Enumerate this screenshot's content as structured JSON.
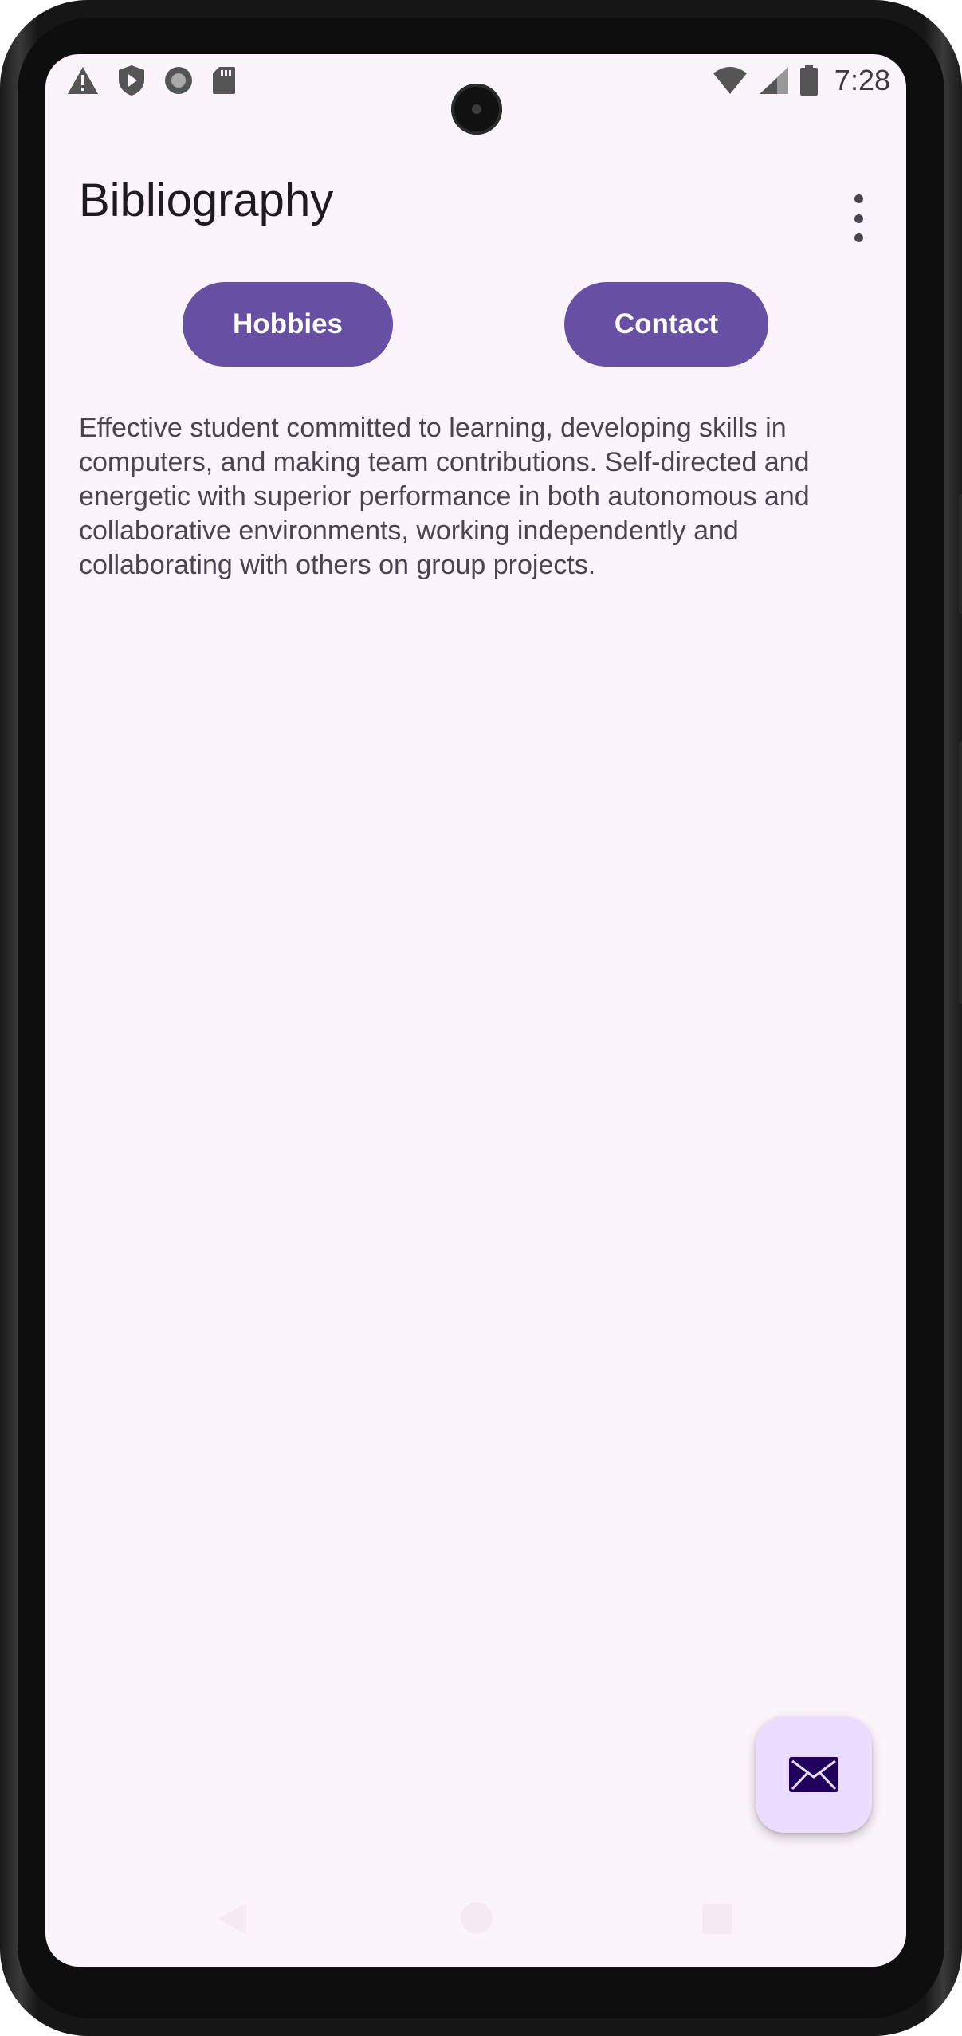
{
  "status_bar": {
    "time": "7:28",
    "left_icons": [
      "warning-icon",
      "shield-play-icon",
      "record-icon",
      "sd-card-icon"
    ],
    "right_icons": [
      "wifi-icon",
      "cell-signal-icon",
      "battery-icon"
    ]
  },
  "app_bar": {
    "title": "Bibliography",
    "menu_icon": "more-vert-icon"
  },
  "buttons": {
    "hobbies_label": "Hobbies",
    "contact_label": "Contact"
  },
  "bio": {
    "text": "Effective student committed to learning, developing skills in computers, and making team contributions. Self-directed and energetic with superior performance in both autonomous and collaborative environments, working independently and collaborating with others on group projects."
  },
  "fab": {
    "icon": "mail-icon"
  },
  "navigation": {
    "icons": [
      "back-icon",
      "home-icon",
      "recents-icon"
    ]
  },
  "colors": {
    "background": "#fcf4fb",
    "primary": "#6750a4",
    "on_primary": "#ffffff",
    "fab_container": "#eaddff",
    "fab_icon": "#21005d",
    "title_text": "#1d1b20",
    "body_text": "#49454f"
  }
}
